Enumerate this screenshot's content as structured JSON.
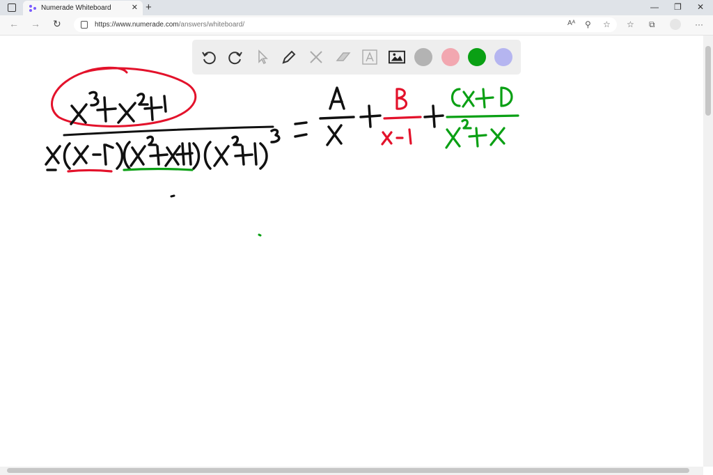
{
  "browser": {
    "tab_title": "Numerade Whiteboard",
    "tab_close": "✕",
    "new_tab": "+",
    "url_host": "https://www.numerade.com",
    "url_path": "/answers/whiteboard/",
    "read_aloud": "Aᴬ",
    "win_min": "—",
    "win_max": "❐",
    "win_close": "✕"
  },
  "toolbar": {
    "tools": [
      "undo-icon",
      "redo-icon",
      "select-icon",
      "pen-icon",
      "tools-icon",
      "eraser-icon",
      "text-icon",
      "image-icon"
    ],
    "colors": [
      "#b3b3b3",
      "#f2a7b0",
      "#0aa014",
      "#b5b5f0"
    ]
  }
}
